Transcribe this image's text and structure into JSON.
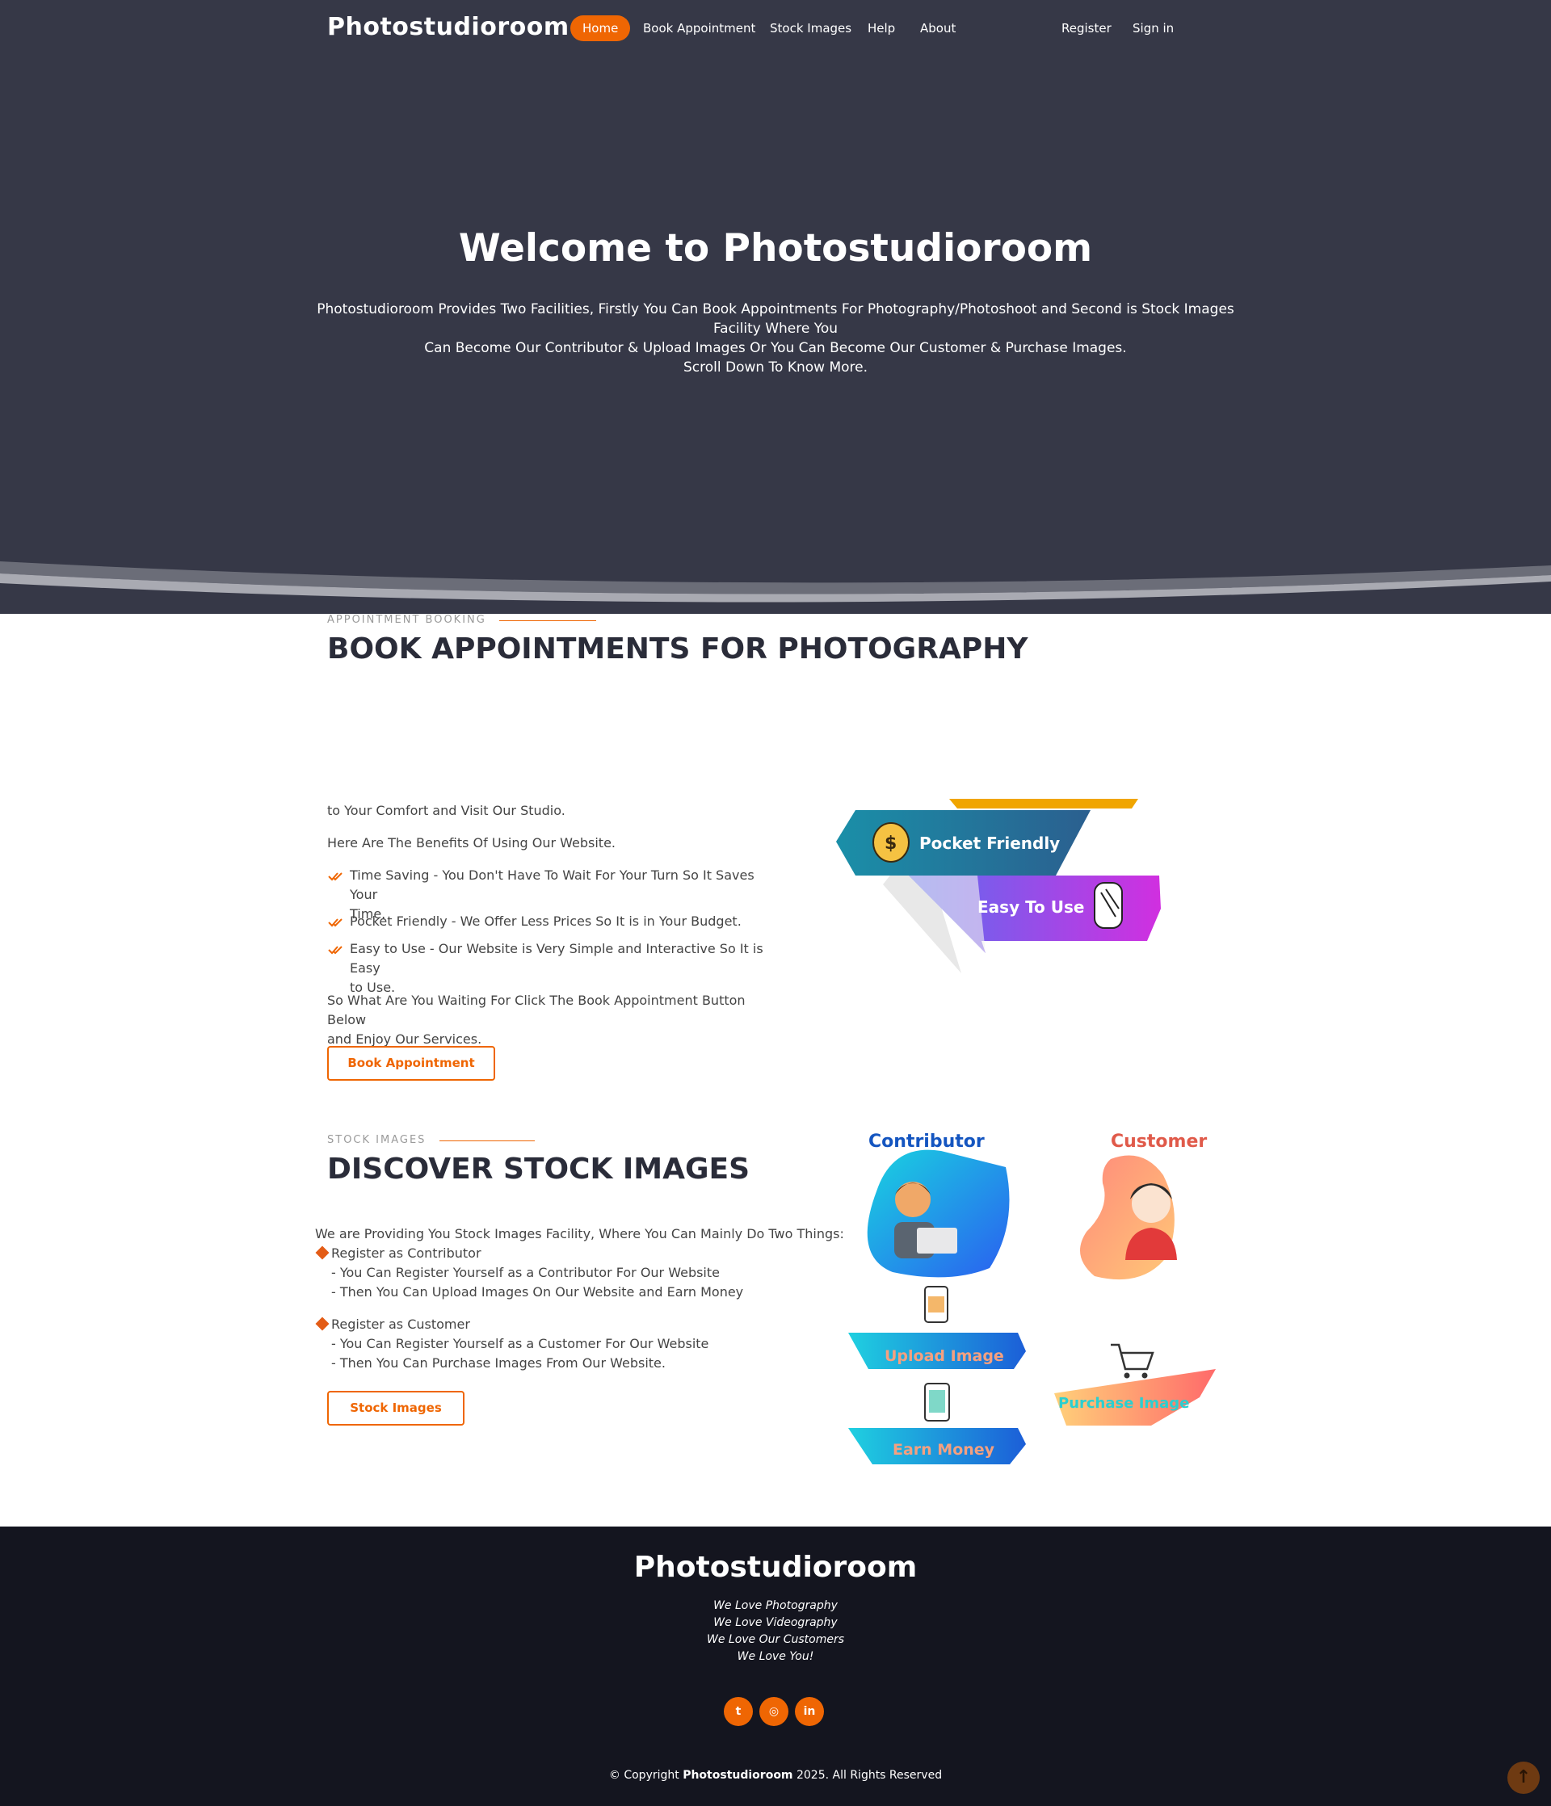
{
  "header": {
    "logo": "Photostudioroom",
    "nav": [
      {
        "label": "Home",
        "active": true
      },
      {
        "label": "Book Appointment",
        "active": false
      },
      {
        "label": "Stock Images",
        "active": false
      },
      {
        "label": "Help",
        "active": false
      },
      {
        "label": "About",
        "active": false
      }
    ],
    "register": "Register",
    "signin": "Sign in"
  },
  "hero": {
    "title": "Welcome to Photostudioroom",
    "desc_line1": "Photostudioroom Provides Two Facilities, Firstly You Can Book Appointments For Photography/Photoshoot and Second is Stock Images Facility Where You",
    "desc_line2": "Can Become Our Contributor & Upload Images Or You Can Become Our Customer & Purchase Images.",
    "desc_line3": "Scroll Down To Know More."
  },
  "appointment": {
    "label": "APPOINTMENT BOOKING",
    "title": "BOOK APPOINTMENTS FOR PHOTOGRAPHY",
    "intro": "to Your Comfort and Visit Our Studio.",
    "benefits_intro": "Here Are The Benefits Of Using Our Website.",
    "benefits": [
      {
        "line1": "Time Saving - You Don't Have To Wait For Your Turn So It Saves Your",
        "line2": "Time."
      },
      {
        "line1": "Pocket Friendly - We Offer Less Prices So It is in Your Budget.",
        "line2": ""
      },
      {
        "line1": "Easy to Use - Our Website is Very Simple and Interactive So It is Easy",
        "line2": "to Use."
      }
    ],
    "outro_line1": "So What Are You Waiting For Click The Book Appointment Button Below",
    "outro_line2": "and Enjoy Our Services.",
    "button": "Book Appointment",
    "graphic": {
      "tag1": "Pocket Friendly",
      "tag2": "Easy To Use",
      "icon1": "money-bag-icon",
      "icon2": "snap-hand-icon"
    }
  },
  "stock": {
    "label": "STOCK IMAGES",
    "title": "DISCOVER STOCK IMAGES",
    "intro": "We are Providing You Stock Images Facility, Where You Can Mainly Do Two Things:",
    "contributor_head": "Register as Contributor",
    "contributor_l1": "- You Can Register Yourself as a Contributor For Our Website",
    "contributor_l2": "- Then You Can Upload Images On Our Website and Earn Money",
    "customer_head": "Register as Customer",
    "customer_l1": "- You Can Register Yourself as a Customer For Our Website",
    "customer_l2": "- Then You Can Purchase Images From Our Website.",
    "button": "Stock Images",
    "graphic": {
      "contributor": "Contributor",
      "customer": "Customer",
      "upload": "Upload Image",
      "earn": "Earn Money",
      "purchase": "Purchase Image"
    }
  },
  "footer": {
    "logo": "Photostudioroom",
    "taglines": [
      "We Love Photography",
      "We Love Videography",
      "We Love Our Customers",
      "We Love You!"
    ],
    "social": [
      {
        "icon": "twitter-icon",
        "glyph": "t"
      },
      {
        "icon": "instagram-icon",
        "glyph": "◎"
      },
      {
        "icon": "linkedin-icon",
        "glyph": "in"
      }
    ],
    "copyright_pre": "© Copyright",
    "copyright_brand": "Photostudioroom",
    "copyright_post": "2025. All Rights Reserved",
    "back_to_top": "↑"
  },
  "colors": {
    "accent": "#ef6603",
    "hero_bg": "#363847",
    "footer_bg": "#14151f",
    "title": "#2a2c39"
  }
}
